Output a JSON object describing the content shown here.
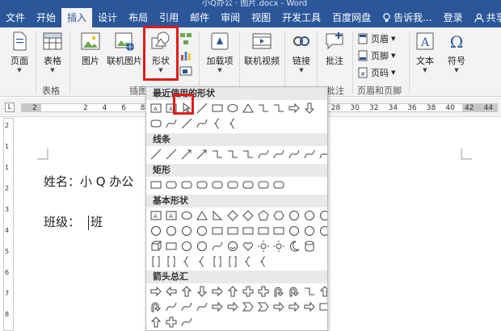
{
  "window": {
    "title": "小Q办公 · 图片.docx - Word"
  },
  "tabs": [
    "文件",
    "开始",
    "插入",
    "设计",
    "布局",
    "引用",
    "邮件",
    "审阅",
    "视图",
    "开发工具",
    "百度网盘"
  ],
  "active_tab": "插入",
  "tellme": "告诉我...",
  "login": "登录",
  "share": "共享",
  "ribbon": {
    "pages": "页面",
    "table": "表格",
    "table_group": "表格",
    "picture": "图片",
    "online_picture": "联机图片",
    "shapes": "形状",
    "illustrations_group": "插图",
    "addins": "加载项",
    "online_video": "联机视频",
    "link": "链接",
    "comment": "批注",
    "comment_group": "批注",
    "header": "页眉",
    "footer": "页脚",
    "page_number": "页码",
    "header_footer_group": "页眉和页脚",
    "text": "文本",
    "symbol": "符号"
  },
  "ruler": {
    "left_num": "2",
    "marks": [
      "2",
      "4",
      "6",
      "8",
      "10",
      "12",
      "14",
      "16",
      "18",
      "20",
      "22",
      "24",
      "26",
      "28",
      "30",
      "32",
      "34",
      "36",
      "38",
      "40",
      "42",
      "44"
    ]
  },
  "vruler": {
    "marks": [
      "2",
      "1",
      "1",
      "2",
      "3",
      "4",
      "5",
      "6",
      "7",
      "8"
    ]
  },
  "document": {
    "line1": "姓名：小 Q 办公",
    "line2_label": "班级：",
    "line2_value": "班"
  },
  "shapes_menu": {
    "recent": "最近使用的形状",
    "lines": "线条",
    "rect": "矩形",
    "basic": "基本形状",
    "arrows": "箭头总汇"
  },
  "colors": {
    "accent": "#2b579a",
    "highlight": "#e01b1b",
    "ribbon_bg": "#f3f3f3"
  }
}
